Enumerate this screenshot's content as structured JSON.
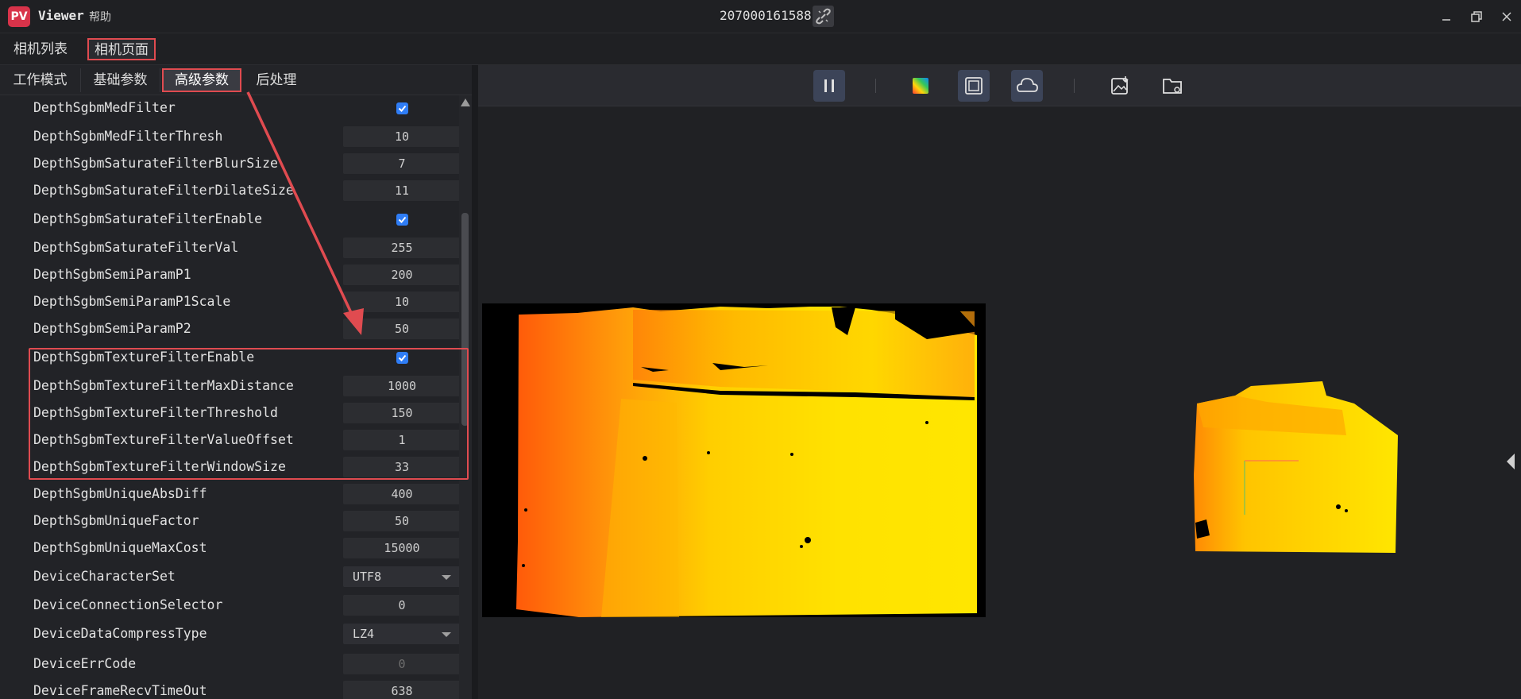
{
  "window": {
    "app_title": "Viewer",
    "logo_text": "PV",
    "help_menu": "帮助",
    "serial_number": "207000161588"
  },
  "top_tabs": [
    {
      "label": "相机列表",
      "selected": false
    },
    {
      "label": "相机页面",
      "selected": true
    }
  ],
  "sub_tabs": [
    {
      "label": "工作模式"
    },
    {
      "label": "基础参数"
    },
    {
      "label": "高级参数",
      "selected": true
    },
    {
      "label": "后处理"
    }
  ],
  "params": [
    {
      "name": "DepthSgbmMedFilter",
      "type": "checkbox",
      "checked": true
    },
    {
      "name": "DepthSgbmMedFilterThresh",
      "type": "number",
      "value": "10"
    },
    {
      "name": "DepthSgbmSaturateFilterBlurSize",
      "type": "number",
      "value": "7"
    },
    {
      "name": "DepthSgbmSaturateFilterDilateSize",
      "type": "number",
      "value": "11"
    },
    {
      "name": "DepthSgbmSaturateFilterEnable",
      "type": "checkbox",
      "checked": true
    },
    {
      "name": "DepthSgbmSaturateFilterVal",
      "type": "number",
      "value": "255"
    },
    {
      "name": "DepthSgbmSemiParamP1",
      "type": "number",
      "value": "200"
    },
    {
      "name": "DepthSgbmSemiParamP1Scale",
      "type": "number",
      "value": "10"
    },
    {
      "name": "DepthSgbmSemiParamP2",
      "type": "number",
      "value": "50"
    },
    {
      "name": "DepthSgbmTextureFilterEnable",
      "type": "checkbox",
      "checked": true
    },
    {
      "name": "DepthSgbmTextureFilterMaxDistance",
      "type": "number",
      "value": "1000"
    },
    {
      "name": "DepthSgbmTextureFilterThreshold",
      "type": "number",
      "value": "150"
    },
    {
      "name": "DepthSgbmTextureFilterValueOffset",
      "type": "number",
      "value": "1"
    },
    {
      "name": "DepthSgbmTextureFilterWindowSize",
      "type": "number",
      "value": "33"
    },
    {
      "name": "DepthSgbmUniqueAbsDiff",
      "type": "number",
      "value": "400"
    },
    {
      "name": "DepthSgbmUniqueFactor",
      "type": "number",
      "value": "50"
    },
    {
      "name": "DepthSgbmUniqueMaxCost",
      "type": "number",
      "value": "15000"
    },
    {
      "name": "DeviceCharacterSet",
      "type": "select",
      "value": "UTF8"
    },
    {
      "name": "DeviceConnectionSelector",
      "type": "number",
      "value": "0"
    },
    {
      "name": "DeviceDataCompressType",
      "type": "select",
      "value": "LZ4"
    },
    {
      "name": "DeviceErrCode",
      "type": "number",
      "value": "0",
      "disabled": true
    },
    {
      "name": "DeviceFrameRecvTimeOut",
      "type": "number",
      "value": "638"
    }
  ],
  "toolbar_icons": [
    "pause-icon",
    "color-map-icon",
    "depth-frame-icon",
    "point-cloud-icon",
    "save-image-icon",
    "open-folder-icon"
  ],
  "colors": {
    "accent_red": "#e04b50",
    "checkbox_blue": "#2f7df6",
    "depth_near": "#ff5a0a",
    "depth_far": "#ffe600"
  }
}
